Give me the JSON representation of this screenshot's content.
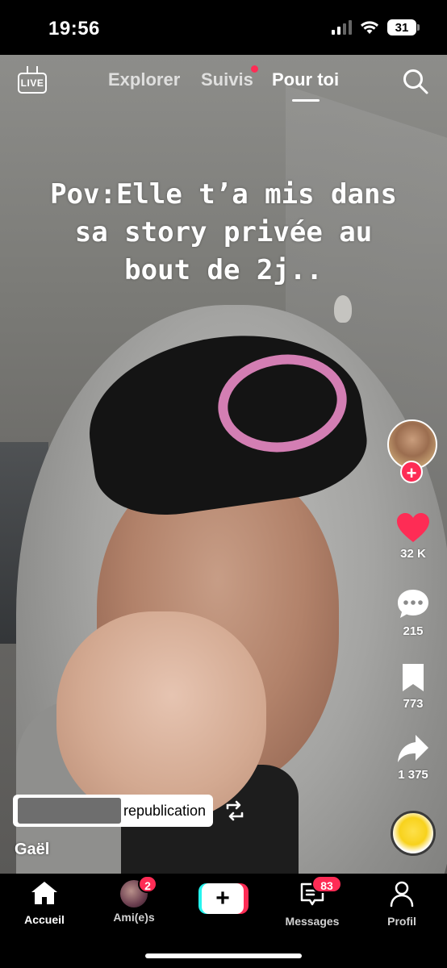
{
  "status_bar": {
    "time": "19:56",
    "battery": "31",
    "icons": [
      "signal-icon",
      "wifi-icon",
      "battery-icon"
    ]
  },
  "top_nav": {
    "live_label": "LIVE",
    "tabs": [
      {
        "label": "Explorer",
        "active": false
      },
      {
        "label": "Suivis",
        "active": false,
        "has_dot": true
      },
      {
        "label": "Pour toi",
        "active": true
      }
    ],
    "search_icon": "search-icon"
  },
  "video": {
    "caption": "Pov:Elle t’a mis dans sa story privée au bout de 2j.."
  },
  "side_actions": {
    "follow_icon": "plus-icon",
    "likes": "32 K",
    "comments": "215",
    "saves": "773",
    "shares": "1 375"
  },
  "post": {
    "repost_text": "republication",
    "author": "Gaël"
  },
  "bottom_nav": {
    "items": [
      {
        "label": "Accueil",
        "icon": "home-icon",
        "active": true
      },
      {
        "label": "Ami(e)s",
        "icon": "friends-avatar",
        "badge": "2"
      },
      {
        "label": "",
        "icon": "create-plus-icon"
      },
      {
        "label": "Messages",
        "icon": "inbox-icon",
        "badge": "83"
      },
      {
        "label": "Profil",
        "icon": "profile-icon"
      }
    ]
  },
  "colors": {
    "accent_red": "#fe2c55",
    "accent_cyan": "#25f4ee",
    "background": "#000000"
  }
}
